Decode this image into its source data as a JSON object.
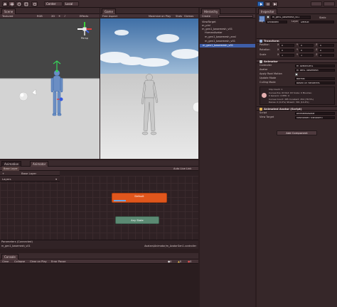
{
  "toolbar": {
    "pivot": "Center",
    "space": "Local"
  },
  "scene": {
    "tab": "Scene",
    "shading": "Textured",
    "mode": "RGB",
    "twoD": "2D",
    "effects": "Effects",
    "gizmo": "Persp"
  },
  "game": {
    "tab": "Game",
    "aspect": "Free Aspect",
    "maximize": "Maximize on Play",
    "stats": "Stats",
    "gizmos": "Gizmos"
  },
  "hierarchy": {
    "tab": "Hierarchy",
    "create": "Create",
    "items": [
      "ViewTarget",
      "m_plnl",
      "m_gen1_basemesh_v01",
      "HumanAvatar",
      "m_gen1_basemesh_ansl",
      "m_gen1_basemesh_v01",
      "m_gen1_basemesh_v01"
    ]
  },
  "inspector": {
    "tab": "Inspector",
    "object_name": "m_gen1_basemesh_v01",
    "tag_label": "Tag",
    "tag_value": "Untagged",
    "layer_label": "Layer",
    "layer_value": "Default",
    "transform": {
      "title": "Transform",
      "position": {
        "label": "Position",
        "x": "0",
        "y": "0",
        "z": "0"
      },
      "rotation": {
        "label": "Rotation",
        "x": "0",
        "y": "0",
        "z": "0"
      },
      "scale": {
        "label": "Scale",
        "x": "1",
        "y": "1",
        "z": "1"
      }
    },
    "animator": {
      "title": "Animator",
      "controller_label": "Controller",
      "controller_value": "m_AvatarGen1",
      "avatar_label": "Avatar",
      "avatar_value": "m_gen1_basemesh",
      "root_motion_label": "Apply Root Motion",
      "update_label": "Update Mode",
      "update_value": "Normal",
      "culling_label": "Culling Mode",
      "culling_value": "Based On Renderers",
      "info": [
        "Clip Count: 1",
        "Curves Pos: 63 Rot: 63 Scale: 0 Muscles:",
        "0 Generic: 0 PPtr: 0",
        "Curves Count: 285 Constant: 454 (78.5%)",
        "Dense: 0 (0.0%) Stream: 301 (14.4%)"
      ]
    },
    "animated_avatar": {
      "title": "Animated Avatar (Script)",
      "script_label": "Script",
      "script_value": "AnimatedAvatar",
      "target_label": "View Target",
      "target_value": "ViewTarget (Transform)"
    },
    "add_component": "Add Component"
  },
  "animator_window": {
    "tab_animation": "Animation",
    "tab_animator": "Animator",
    "base_layer_crumb": "Base Layer",
    "auto_live": "Auto Live Link",
    "base_layer_item": "Base Layer",
    "layers_label": "Layers",
    "state_default": "Default",
    "state_any": "Any State",
    "params_label": "Parameters (Connected)",
    "footer_left": "m_gen1_basemesh_v01",
    "footer_right": "Avatars/Animator/m_AvatarGen1.controller"
  },
  "console": {
    "tab": "Console",
    "clear": "Clear",
    "collapse": "Collapse",
    "clear_on_play": "Clear on Play",
    "error_pause": "Error Pause",
    "count_info": "0",
    "count_warn": "0",
    "count_error": "0"
  },
  "colors": {
    "accent_blue": "#3e5ea8",
    "default_state": "#e0561c",
    "any_state": "#5b8a73"
  }
}
